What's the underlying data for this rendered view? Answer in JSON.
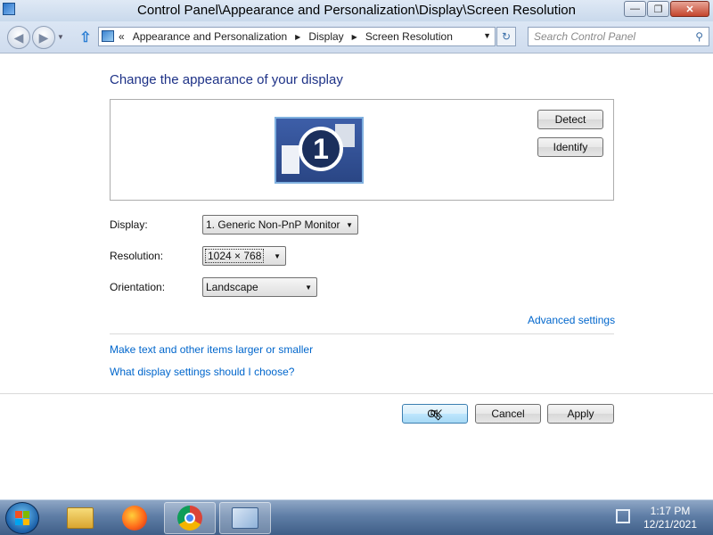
{
  "window": {
    "title": "Control Panel\\Appearance and Personalization\\Display\\Screen Resolution",
    "min_glyph": "—",
    "max_glyph": "❐",
    "close_glyph": "✕"
  },
  "address": {
    "prefix": "«",
    "crumbs": [
      "Appearance and Personalization",
      "Display",
      "Screen Resolution"
    ],
    "search_placeholder": "Search Control Panel"
  },
  "content": {
    "heading": "Change the appearance of your display",
    "monitor_number": "1",
    "detect_label": "Detect",
    "identify_label": "Identify",
    "display_label": "Display:",
    "display_value": "1. Generic Non-PnP Monitor",
    "resolution_label": "Resolution:",
    "resolution_value": "1024 × 768",
    "orientation_label": "Orientation:",
    "orientation_value": "Landscape",
    "advanced_link": "Advanced settings",
    "text_size_link": "Make text and other items larger or smaller",
    "help_link": "What display settings should I choose?",
    "ok_label": "OK",
    "cancel_label": "Cancel",
    "apply_label": "Apply"
  },
  "taskbar": {
    "apps": [
      "windows-explorer-icon",
      "firefox-icon",
      "chrome-icon",
      "display-settings-icon"
    ],
    "time": "1:17 PM",
    "date": "12/21/2021"
  }
}
